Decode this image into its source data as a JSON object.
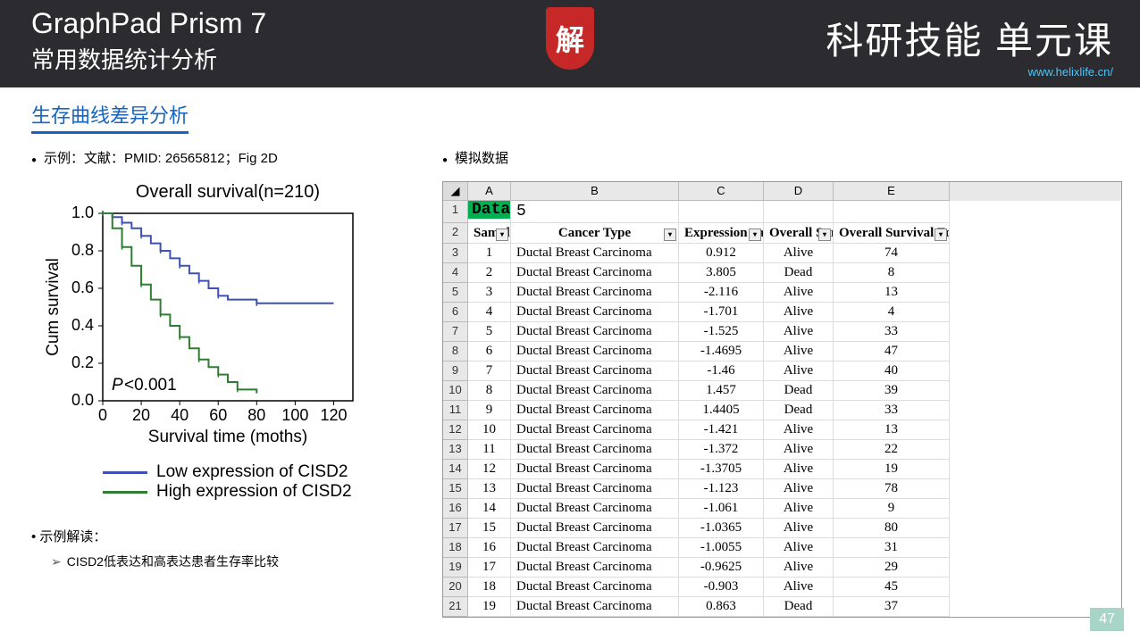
{
  "header": {
    "title1": "GraphPad Prism 7",
    "title2": "常用数据统计分析",
    "right_title": "科研技能 单元课",
    "url": "www.helixlife.cn/",
    "logo": "解"
  },
  "section_title": "生存曲线差异分析",
  "left": {
    "bullet": "示例：文献：PMID: 26565812；Fig 2D",
    "interp_label": "示例解读：",
    "interp_item": "CISD2低表达和高表达患者生存率比较"
  },
  "right_bullet": "模拟数据",
  "chart_data": {
    "type": "line",
    "title": "Overall survival(n=210)",
    "xlabel": "Survival time (moths)",
    "ylabel": "Cum survival",
    "xlim": [
      0,
      130
    ],
    "ylim": [
      0,
      1.0
    ],
    "xticks": [
      0,
      20,
      40,
      60,
      80,
      100,
      120
    ],
    "yticks": [
      0.0,
      0.2,
      0.4,
      0.6,
      0.8,
      1.0
    ],
    "annotation": "P<0.001",
    "series": [
      {
        "name": "Low expression of CISD2",
        "color": "#3f51b5",
        "x": [
          0,
          5,
          10,
          15,
          20,
          25,
          30,
          35,
          40,
          45,
          50,
          55,
          60,
          65,
          80,
          120
        ],
        "y": [
          1.0,
          0.98,
          0.95,
          0.92,
          0.88,
          0.84,
          0.8,
          0.76,
          0.72,
          0.68,
          0.64,
          0.6,
          0.56,
          0.54,
          0.52,
          0.52
        ]
      },
      {
        "name": "High expression of CISD2",
        "color": "#2e7d32",
        "x": [
          0,
          5,
          10,
          15,
          20,
          25,
          30,
          35,
          40,
          45,
          50,
          55,
          60,
          65,
          70,
          80
        ],
        "y": [
          1.0,
          0.92,
          0.82,
          0.72,
          0.62,
          0.54,
          0.46,
          0.4,
          0.34,
          0.28,
          0.22,
          0.18,
          0.14,
          0.1,
          0.06,
          0.04
        ]
      }
    ],
    "legend": [
      {
        "label": "Low expression of CISD2",
        "color": "#3f51b5"
      },
      {
        "label": "High expression of CISD2",
        "color": "#2e7d32"
      }
    ]
  },
  "excel": {
    "col_letters": [
      "A",
      "B",
      "C",
      "D",
      "E"
    ],
    "data_label": "Data",
    "data_num": "5",
    "headers": [
      "Sample No",
      "Cancer Type",
      "Expression value",
      "Overall Survival Status",
      "Overall Survival Followup Time (Months)"
    ],
    "rows": [
      {
        "n": 1,
        "t": "Ductal Breast Carcinoma",
        "e": "0.912",
        "s": "Alive",
        "m": "74"
      },
      {
        "n": 2,
        "t": "Ductal Breast Carcinoma",
        "e": "3.805",
        "s": "Dead",
        "m": "8"
      },
      {
        "n": 3,
        "t": "Ductal Breast Carcinoma",
        "e": "-2.116",
        "s": "Alive",
        "m": "13"
      },
      {
        "n": 4,
        "t": "Ductal Breast Carcinoma",
        "e": "-1.701",
        "s": "Alive",
        "m": "4"
      },
      {
        "n": 5,
        "t": "Ductal Breast Carcinoma",
        "e": "-1.525",
        "s": "Alive",
        "m": "33"
      },
      {
        "n": 6,
        "t": "Ductal Breast Carcinoma",
        "e": "-1.4695",
        "s": "Alive",
        "m": "47"
      },
      {
        "n": 7,
        "t": "Ductal Breast Carcinoma",
        "e": "-1.46",
        "s": "Alive",
        "m": "40"
      },
      {
        "n": 8,
        "t": "Ductal Breast Carcinoma",
        "e": "1.457",
        "s": "Dead",
        "m": "39"
      },
      {
        "n": 9,
        "t": "Ductal Breast Carcinoma",
        "e": "1.4405",
        "s": "Dead",
        "m": "33"
      },
      {
        "n": 10,
        "t": "Ductal Breast Carcinoma",
        "e": "-1.421",
        "s": "Alive",
        "m": "13"
      },
      {
        "n": 11,
        "t": "Ductal Breast Carcinoma",
        "e": "-1.372",
        "s": "Alive",
        "m": "22"
      },
      {
        "n": 12,
        "t": "Ductal Breast Carcinoma",
        "e": "-1.3705",
        "s": "Alive",
        "m": "19"
      },
      {
        "n": 13,
        "t": "Ductal Breast Carcinoma",
        "e": "-1.123",
        "s": "Alive",
        "m": "78"
      },
      {
        "n": 14,
        "t": "Ductal Breast Carcinoma",
        "e": "-1.061",
        "s": "Alive",
        "m": "9"
      },
      {
        "n": 15,
        "t": "Ductal Breast Carcinoma",
        "e": "-1.0365",
        "s": "Alive",
        "m": "80"
      },
      {
        "n": 16,
        "t": "Ductal Breast Carcinoma",
        "e": "-1.0055",
        "s": "Alive",
        "m": "31"
      },
      {
        "n": 17,
        "t": "Ductal Breast Carcinoma",
        "e": "-0.9625",
        "s": "Alive",
        "m": "29"
      },
      {
        "n": 18,
        "t": "Ductal Breast Carcinoma",
        "e": "-0.903",
        "s": "Alive",
        "m": "45"
      },
      {
        "n": 19,
        "t": "Ductal Breast Carcinoma",
        "e": "0.863",
        "s": "Dead",
        "m": "37"
      }
    ]
  },
  "page_num": "47"
}
